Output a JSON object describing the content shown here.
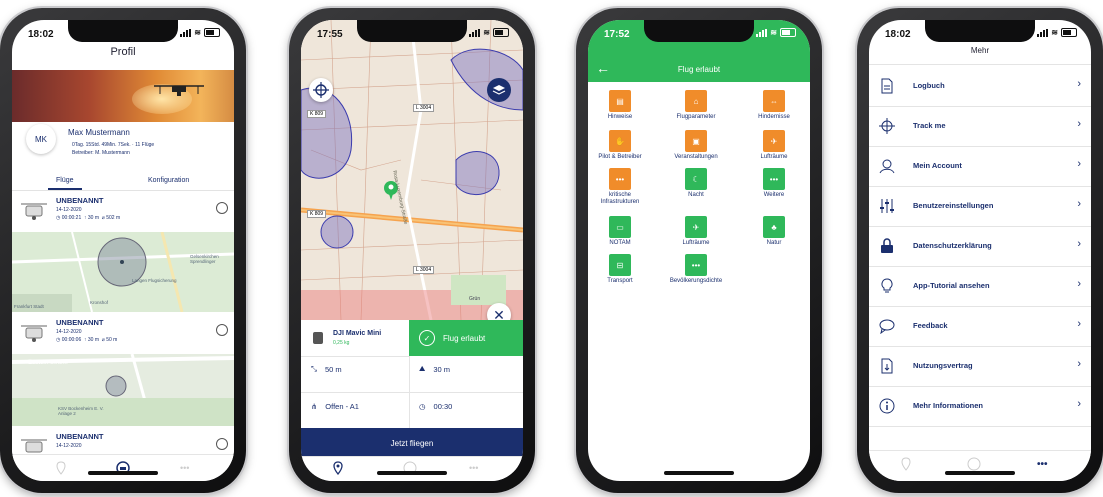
{
  "colors": {
    "navy": "#1b2f6e",
    "green": "#2fb85a",
    "orange": "#f08c2a"
  },
  "screen1": {
    "time": "18:02",
    "title": "Profil",
    "avatar_initials": "MK",
    "name": "Max Mustermann",
    "stats": "0Tag. 15Std. 49Min. 7Sek. · 11 Flüge",
    "operator": "Betreiber: M. Mustermann",
    "tabs": [
      {
        "label": "Flüge",
        "active": true
      },
      {
        "label": "Konfiguration",
        "active": false
      }
    ],
    "flights": [
      {
        "name": "UNBENANNT",
        "date": "14-12-2020",
        "duration": "00:00:21",
        "height": "30 m",
        "distance": "502 m"
      },
      {
        "name": "UNBENANNT",
        "date": "14-12-2020",
        "duration": "00:00:06",
        "height": "30 m",
        "distance": "50 m"
      },
      {
        "name": "UNBENANNT",
        "date": "14-12-2020"
      }
    ],
    "map1_labels": [
      "Gelsenkirchen Sprendlinger",
      "Langen Flugsicherung",
      "Kronshof",
      "Frankfurt Stadt"
    ],
    "map2_labels": [
      "Eastein-Straße",
      "KSV Bockenheim E. V. Anlage 2"
    ],
    "tab_icons": [
      "location-icon",
      "drone-icon",
      "more-icon"
    ]
  },
  "screen2": {
    "time": "17:55",
    "map_labels": [
      "L 3004",
      "K 809",
      "K 809",
      "L 3004",
      "Rosa-Luxemburg-Straße",
      "Grün"
    ],
    "drone_name": "DJI Mavic Mini",
    "drone_weight": "0,25 kg",
    "status": "Flug erlaubt",
    "max_distance": "50 m",
    "max_height": "30 m",
    "category": "Offen - A1",
    "duration": "00:30",
    "cta": "Jetzt fliegen"
  },
  "screen3": {
    "time": "17:52",
    "title": "Flug erlaubt",
    "rules": [
      {
        "label": "Hinweise",
        "color": "orange"
      },
      {
        "label": "Flugparameter",
        "color": "orange"
      },
      {
        "label": "Hindernisse",
        "color": "orange"
      },
      {
        "label": "Pilot & Betreiber",
        "color": "orange"
      },
      {
        "label": "Veranstaltungen",
        "color": "orange"
      },
      {
        "label": "Lufträume",
        "color": "orange"
      },
      {
        "label": "kritische Infrastrukturen",
        "color": "orange"
      },
      {
        "label": "Nacht",
        "color": "green"
      },
      {
        "label": "Weitere",
        "color": "green"
      },
      {
        "label": "NOTAM",
        "color": "green"
      },
      {
        "label": "Lufträume",
        "color": "green"
      },
      {
        "label": "Natur",
        "color": "green"
      },
      {
        "label": "Transport",
        "color": "green"
      },
      {
        "label": "Bevölkerungsdichte",
        "color": "green"
      }
    ]
  },
  "screen4": {
    "time": "18:02",
    "title": "Mehr",
    "items": [
      {
        "label": "Logbuch",
        "icon": "document-icon"
      },
      {
        "label": "Track me",
        "icon": "crosshair-icon"
      },
      {
        "label": "Mein Account",
        "icon": "user-icon"
      },
      {
        "label": "Benutzereinstellungen",
        "icon": "sliders-icon"
      },
      {
        "label": "Datenschutzerklärung",
        "icon": "lock-icon"
      },
      {
        "label": "App-Tutorial ansehen",
        "icon": "lightbulb-icon"
      },
      {
        "label": "Feedback",
        "icon": "chat-icon"
      },
      {
        "label": "Nutzungsvertrag",
        "icon": "contract-icon"
      },
      {
        "label": "Mehr Informationen",
        "icon": "info-icon"
      }
    ],
    "more_glyph": "•••"
  }
}
